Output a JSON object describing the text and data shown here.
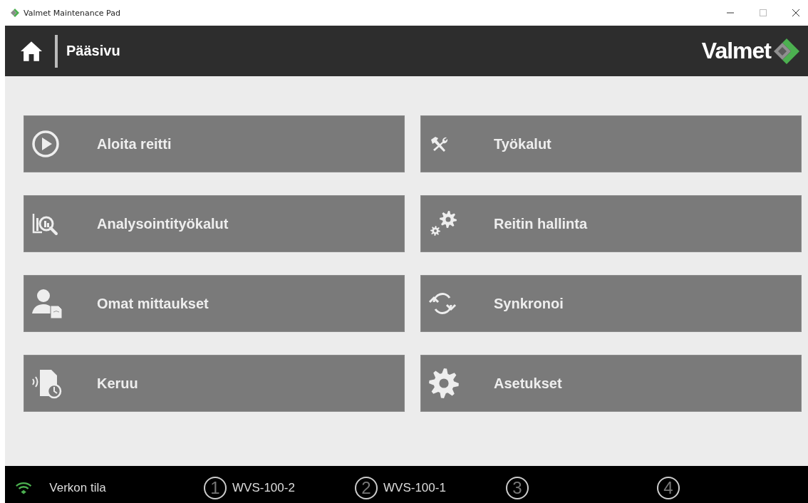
{
  "window": {
    "title": "Valmet Maintenance Pad"
  },
  "header": {
    "title": "Pääsivu",
    "brand": "Valmet"
  },
  "tiles": [
    {
      "label": "Aloita reitti"
    },
    {
      "label": "Työkalut"
    },
    {
      "label": "Analysointityökalut"
    },
    {
      "label": "Reitin hallinta"
    },
    {
      "label": "Omat mittaukset"
    },
    {
      "label": "Synkronoi"
    },
    {
      "label": "Keruu"
    },
    {
      "label": "Asetukset"
    }
  ],
  "status_bar": {
    "network": "Verkon tila",
    "channels": [
      {
        "number": "1",
        "device": "WVS-100-2"
      },
      {
        "number": "2",
        "device": "WVS-100-1"
      },
      {
        "number": "3"
      },
      {
        "number": "4"
      }
    ]
  }
}
